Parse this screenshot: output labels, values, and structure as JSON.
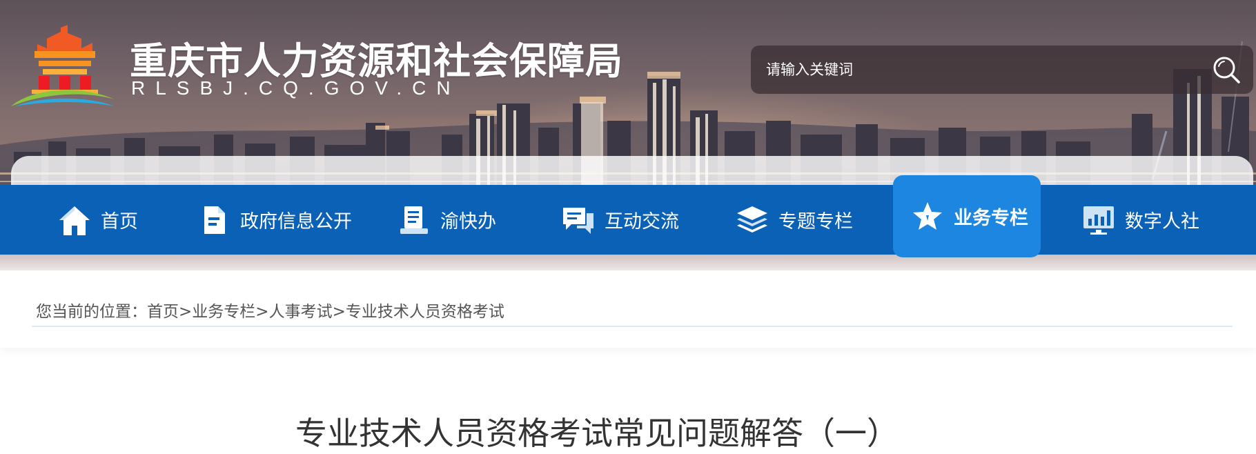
{
  "header": {
    "site_title": "重庆市人力资源和社会保障局",
    "site_domain": "RLSBJ.CQ.GOV.CN",
    "logo": "city-gate-logo"
  },
  "search": {
    "placeholder": "请输入关键词",
    "icon": "search-icon"
  },
  "nav": {
    "items": [
      {
        "label": "首页",
        "icon": "home-icon",
        "active": false
      },
      {
        "label": "政府信息公开",
        "icon": "document-icon",
        "active": false
      },
      {
        "label": "渝快办",
        "icon": "clipboard-icon",
        "active": false
      },
      {
        "label": "互动交流",
        "icon": "chat-icon",
        "active": false
      },
      {
        "label": "专题专栏",
        "icon": "layers-icon",
        "active": false
      },
      {
        "label": "业务专栏",
        "icon": "star-icon",
        "active": true
      },
      {
        "label": "数字人社",
        "icon": "monitor-chart-icon",
        "active": false
      }
    ]
  },
  "breadcrumb": {
    "prefix": "您当前的位置：",
    "items": [
      "首页",
      "业务专栏",
      "人事考试",
      "专业技术人员资格考试"
    ],
    "separator": ">"
  },
  "article": {
    "title": "专业技术人员资格考试常见问题解答（一）"
  },
  "colors": {
    "nav_bg": "#0b61b6",
    "nav_active": "#1c86e0",
    "text": "#333333"
  }
}
